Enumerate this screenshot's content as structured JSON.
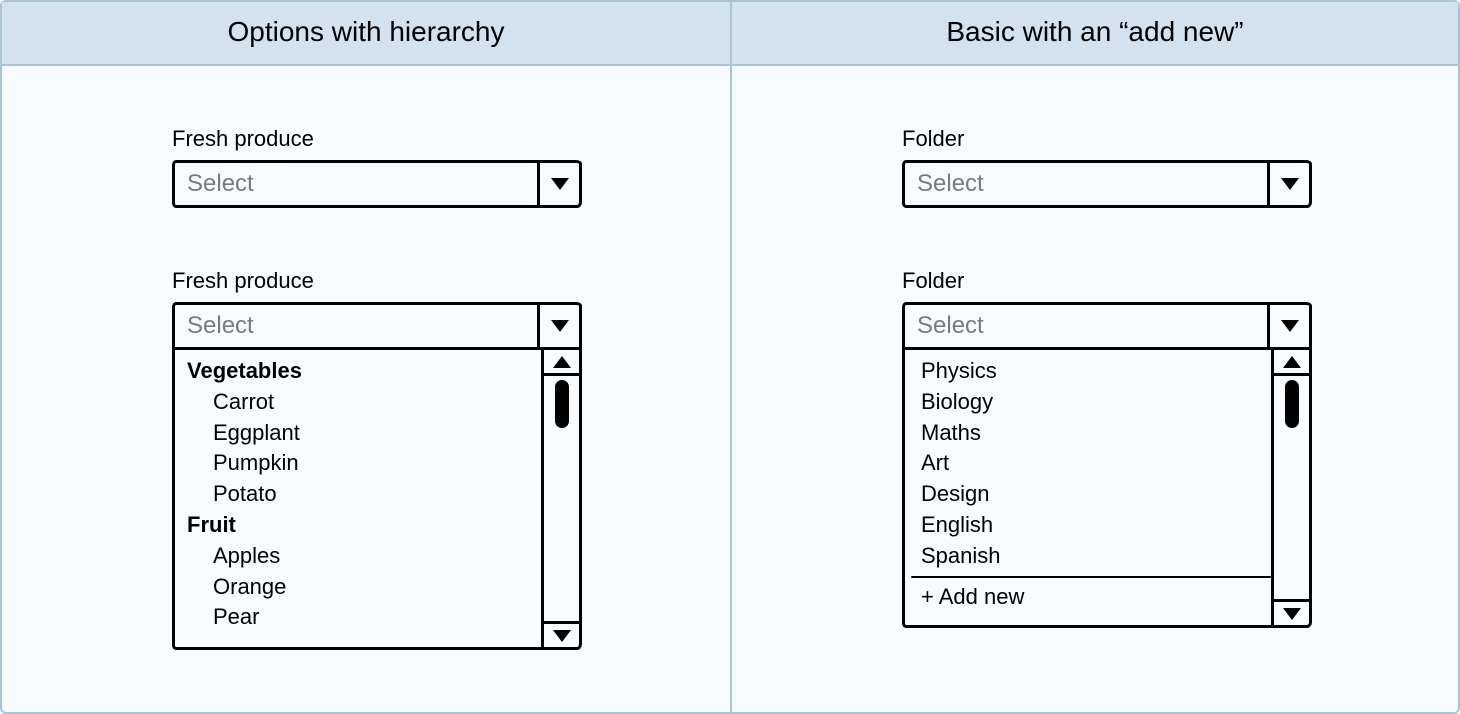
{
  "left": {
    "title": "Options with hierarchy",
    "closed": {
      "label": "Fresh produce",
      "placeholder": "Select"
    },
    "open": {
      "label": "Fresh produce",
      "placeholder": "Select",
      "groups": [
        {
          "name": "Vegetables",
          "items": [
            "Carrot",
            "Eggplant",
            "Pumpkin",
            "Potato"
          ]
        },
        {
          "name": "Fruit",
          "items": [
            "Apples",
            "Orange",
            "Pear"
          ]
        }
      ]
    }
  },
  "right": {
    "title": "Basic with an “add new”",
    "closed": {
      "label": "Folder",
      "placeholder": "Select"
    },
    "open": {
      "label": "Folder",
      "placeholder": "Select",
      "items": [
        "Physics",
        "Biology",
        "Maths",
        "Art",
        "Design",
        "English",
        "Spanish"
      ],
      "add_new": "+ Add new"
    }
  }
}
